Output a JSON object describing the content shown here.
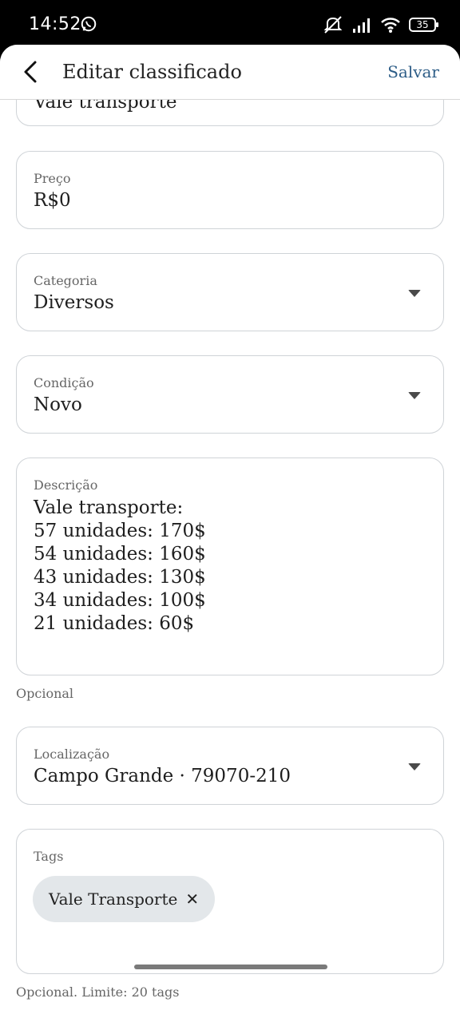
{
  "status_bar": {
    "time": "14:52",
    "battery": "35",
    "icons": [
      "whatsapp-icon",
      "mute-icon",
      "signal-icon",
      "wifi-icon",
      "battery-icon"
    ]
  },
  "appbar": {
    "title": "Editar classificado",
    "save_label": "Salvar"
  },
  "form": {
    "title_value_partial": "Vale transporte",
    "price": {
      "label": "Preço",
      "value": "R$0"
    },
    "category": {
      "label": "Categoria",
      "value": "Diversos"
    },
    "condition": {
      "label": "Condição",
      "value": "Novo"
    },
    "description": {
      "label": "Descrição",
      "lines": [
        "Vale transporte:",
        "57 unidades: 170$",
        "54 unidades: 160$",
        "43 unidades: 130$",
        "34 unidades: 100$",
        "21 unidades: 60$"
      ],
      "helper": "Opcional"
    },
    "location": {
      "label": "Localização",
      "value": "Campo Grande · 79070-210"
    },
    "tags": {
      "label": "Tags",
      "chips": [
        "Vale Transporte"
      ],
      "remove_symbol": "✕",
      "helper": "Opcional. Limite: 20 tags"
    }
  }
}
